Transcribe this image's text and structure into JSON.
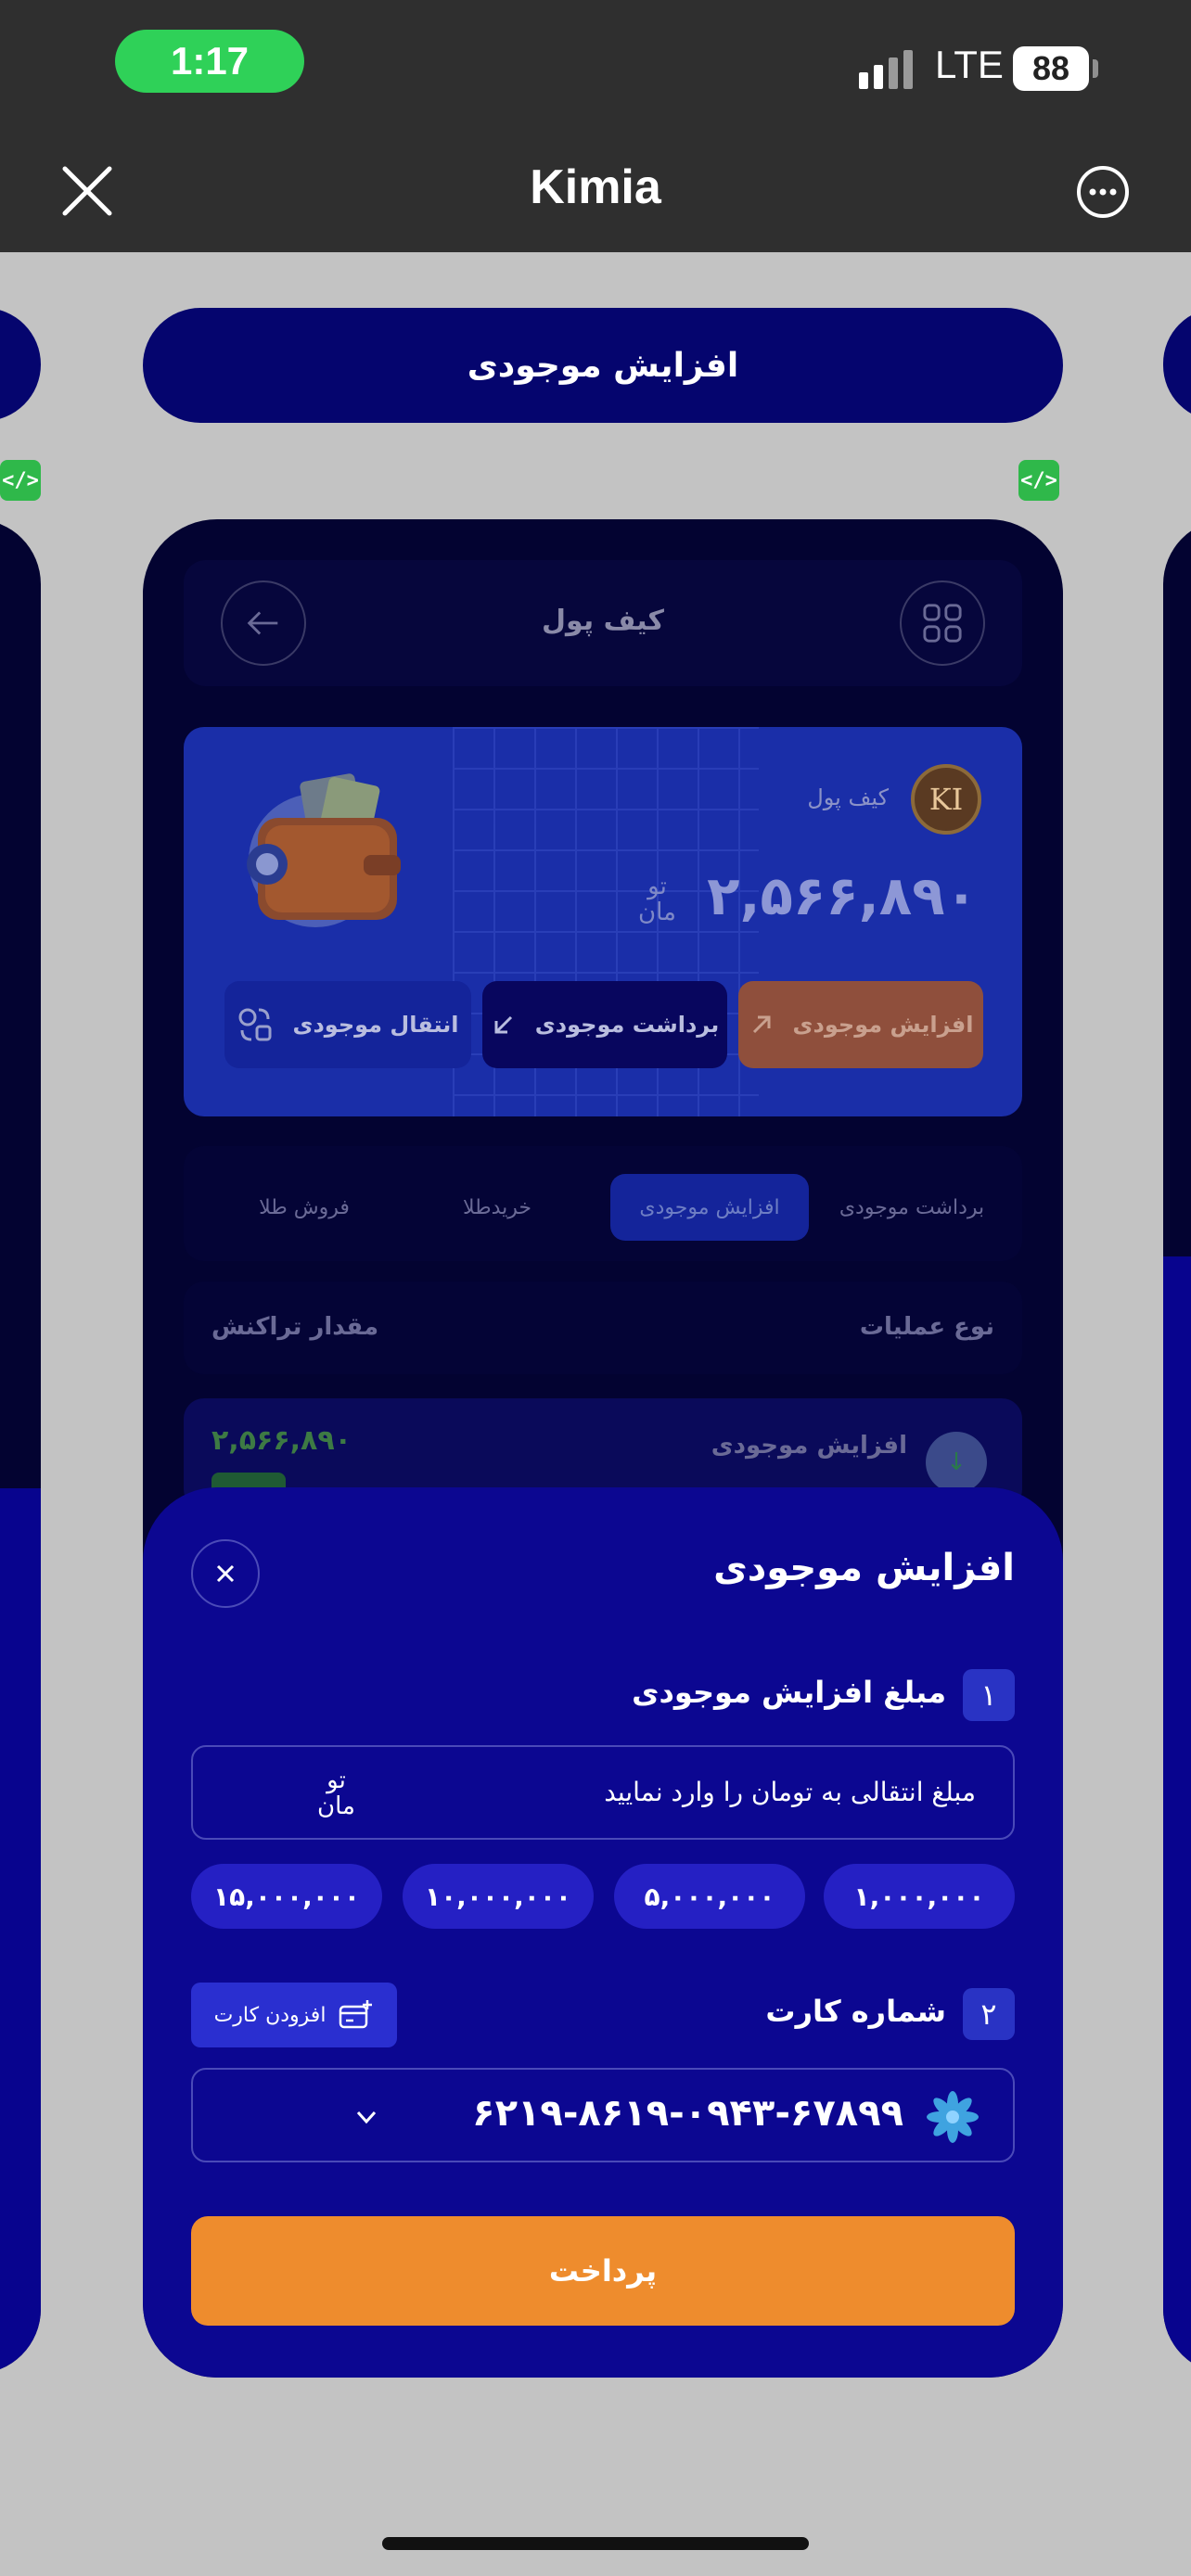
{
  "status_bar": {
    "time": "1:17",
    "network": "LTE",
    "battery": "88"
  },
  "app_bar": {
    "title": "Kimia"
  },
  "page": {
    "title_pill": "افزایش موجودی",
    "code_badge": "</>"
  },
  "wallet_screen": {
    "header_title": "کیف پول",
    "logo_text": "KI",
    "wallet_label": "کیف پول",
    "balance": "۲,۵۶۶,۸۹۰",
    "currency_top": "تو",
    "currency_bottom": "مان",
    "actions": {
      "increase": "افزایش موجودی",
      "withdraw": "برداشت موجودی",
      "transfer": "انتقال موجودی"
    },
    "tabs": [
      "برداشت موجودی",
      "افزایش موجودی",
      "خریدطلا",
      "فروش طلا"
    ],
    "active_tab_index": 1,
    "table_headers": {
      "type": "نوع عملیات",
      "amount": "مقدار تراکنش"
    },
    "rows": [
      {
        "type": "افزایش موجودی",
        "amount": "۲,۵۶۶,۸۹۰",
        "icon": "arrow-down-icon"
      }
    ]
  },
  "sheet": {
    "title": "افزایش موجودی",
    "step1_num": "۱",
    "step1_label": "مبلغ افزایش موجودی",
    "amount_placeholder": "مبلغ انتقالی به تومان را وارد نمایید",
    "unit_top": "تو",
    "unit_bottom": "مان",
    "presets": [
      "۱,۰۰۰,۰۰۰",
      "۵,۰۰۰,۰۰۰",
      "۱۰,۰۰۰,۰۰۰",
      "۱۵,۰۰۰,۰۰۰"
    ],
    "step2_num": "۲",
    "step2_label": "شماره کارت",
    "add_card_label": "افزودن کارت",
    "card_number": "۶۲۱۹-۸۶۱۹-۰۹۴۳-۶۷۸۹۹",
    "pay_label": "پرداخت"
  },
  "colors": {
    "sheet_bg": "#0c0791",
    "pay_orange": "#ee8c2d",
    "status_green": "#2fd158",
    "title_pill": "#05056e"
  }
}
